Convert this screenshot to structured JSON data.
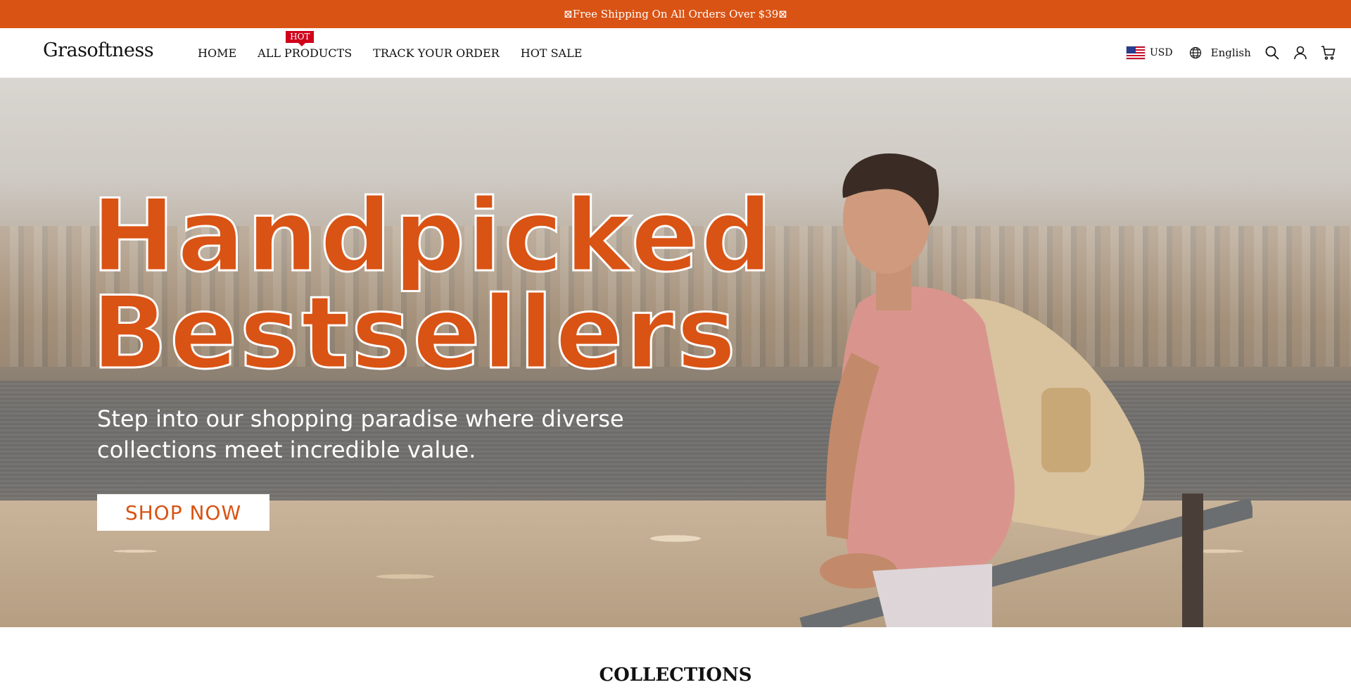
{
  "announcement": {
    "text": "⊠Free Shipping On All Orders Over $39⊠"
  },
  "header": {
    "logo": "Grasoftness",
    "nav": [
      {
        "label": "HOME"
      },
      {
        "label": "ALL PRODUCTS",
        "badge": "HOT"
      },
      {
        "label": "TRACK YOUR ORDER"
      },
      {
        "label": "HOT SALE"
      }
    ],
    "currency": "USD",
    "language": "English",
    "icons": [
      "us-flag-icon",
      "globe-icon",
      "search-icon",
      "account-icon",
      "cart-icon"
    ]
  },
  "hero": {
    "headline_line1": "Handpicked",
    "headline_line2": "Bestsellers",
    "subtext": "Step into our shopping paradise where diverse collections meet incredible value.",
    "cta_label": "SHOP NOW"
  },
  "sections": {
    "collections_title": "COLLECTIONS"
  },
  "colors": {
    "accent": "#d95314",
    "badge": "#d0021b"
  }
}
